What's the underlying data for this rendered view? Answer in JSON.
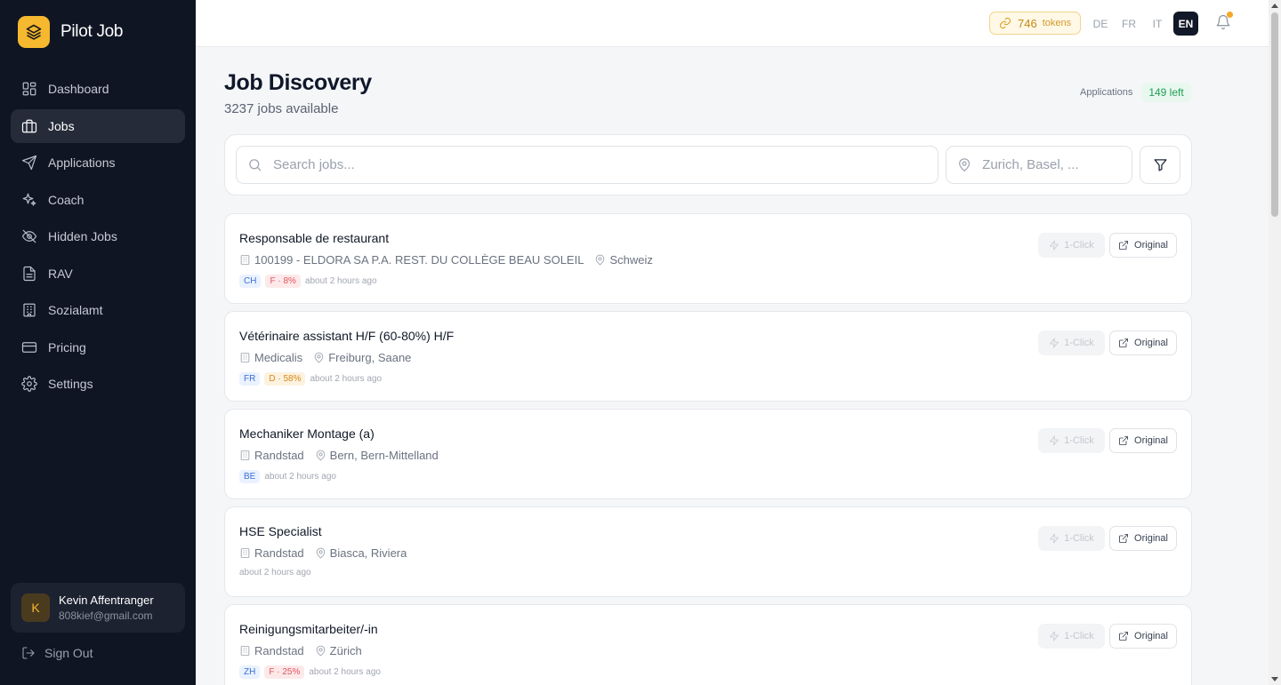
{
  "app": {
    "name": "Pilot Job"
  },
  "sidebar": {
    "items": [
      {
        "label": "Dashboard",
        "icon": "dashboard-icon",
        "active": false
      },
      {
        "label": "Jobs",
        "icon": "briefcase-icon",
        "active": true
      },
      {
        "label": "Applications",
        "icon": "send-icon",
        "active": false
      },
      {
        "label": "Coach",
        "icon": "sparkles-icon",
        "active": false
      },
      {
        "label": "Hidden Jobs",
        "icon": "eye-off-icon",
        "active": false
      },
      {
        "label": "RAV",
        "icon": "document-icon",
        "active": false
      },
      {
        "label": "Sozialamt",
        "icon": "building-icon",
        "active": false
      },
      {
        "label": "Pricing",
        "icon": "credit-card-icon",
        "active": false
      },
      {
        "label": "Settings",
        "icon": "gear-icon",
        "active": false
      }
    ],
    "user": {
      "initial": "K",
      "name": "Kevin Affentranger",
      "email": "808kief@gmail.com"
    },
    "signout_label": "Sign Out"
  },
  "topbar": {
    "tokens_count": "746",
    "tokens_label": "tokens",
    "languages": [
      "DE",
      "FR",
      "IT",
      "EN"
    ],
    "active_language": "EN",
    "has_notification": true
  },
  "main": {
    "title": "Job Discovery",
    "subtitle": "3237 jobs available",
    "applications_label": "Applications",
    "applications_left": "149 left",
    "search_placeholder": "Search jobs...",
    "location_placeholder": "Zurich, Basel, ...",
    "one_click_label": "1-Click",
    "original_label": "Original"
  },
  "jobs": [
    {
      "title": "Responsable de restaurant",
      "company": "100199 - ELDORA SA P.A. REST. DU COLLÈGE BEAU SOLEIL",
      "location": "Schweiz",
      "canton": "CH",
      "score": "F · 8%",
      "score_color": "red",
      "time": "about 2 hours ago"
    },
    {
      "title": "Vétérinaire assistant H/F (60-80%) H/F",
      "company": "Medicalis",
      "location": "Freiburg, Saane",
      "canton": "FR",
      "score": "D · 58%",
      "score_color": "orange",
      "time": "about 2 hours ago"
    },
    {
      "title": "Mechaniker Montage (a)",
      "company": "Randstad",
      "location": "Bern, Bern-Mittelland",
      "canton": "BE",
      "score": "",
      "score_color": "",
      "time": "about 2 hours ago"
    },
    {
      "title": "HSE Specialist",
      "company": "Randstad",
      "location": "Biasca, Riviera",
      "canton": "",
      "score": "",
      "score_color": "",
      "time": "about 2 hours ago"
    },
    {
      "title": "Reinigungsmitarbeiter/-in",
      "company": "Randstad",
      "location": "Zürich",
      "canton": "ZH",
      "score": "F · 25%",
      "score_color": "red",
      "time": "about 2 hours ago"
    }
  ],
  "colors": {
    "sidebar_bg": "#0f1523",
    "accent": "#f5b82e",
    "active_lang": "#111827",
    "success": "#1f9d55"
  }
}
